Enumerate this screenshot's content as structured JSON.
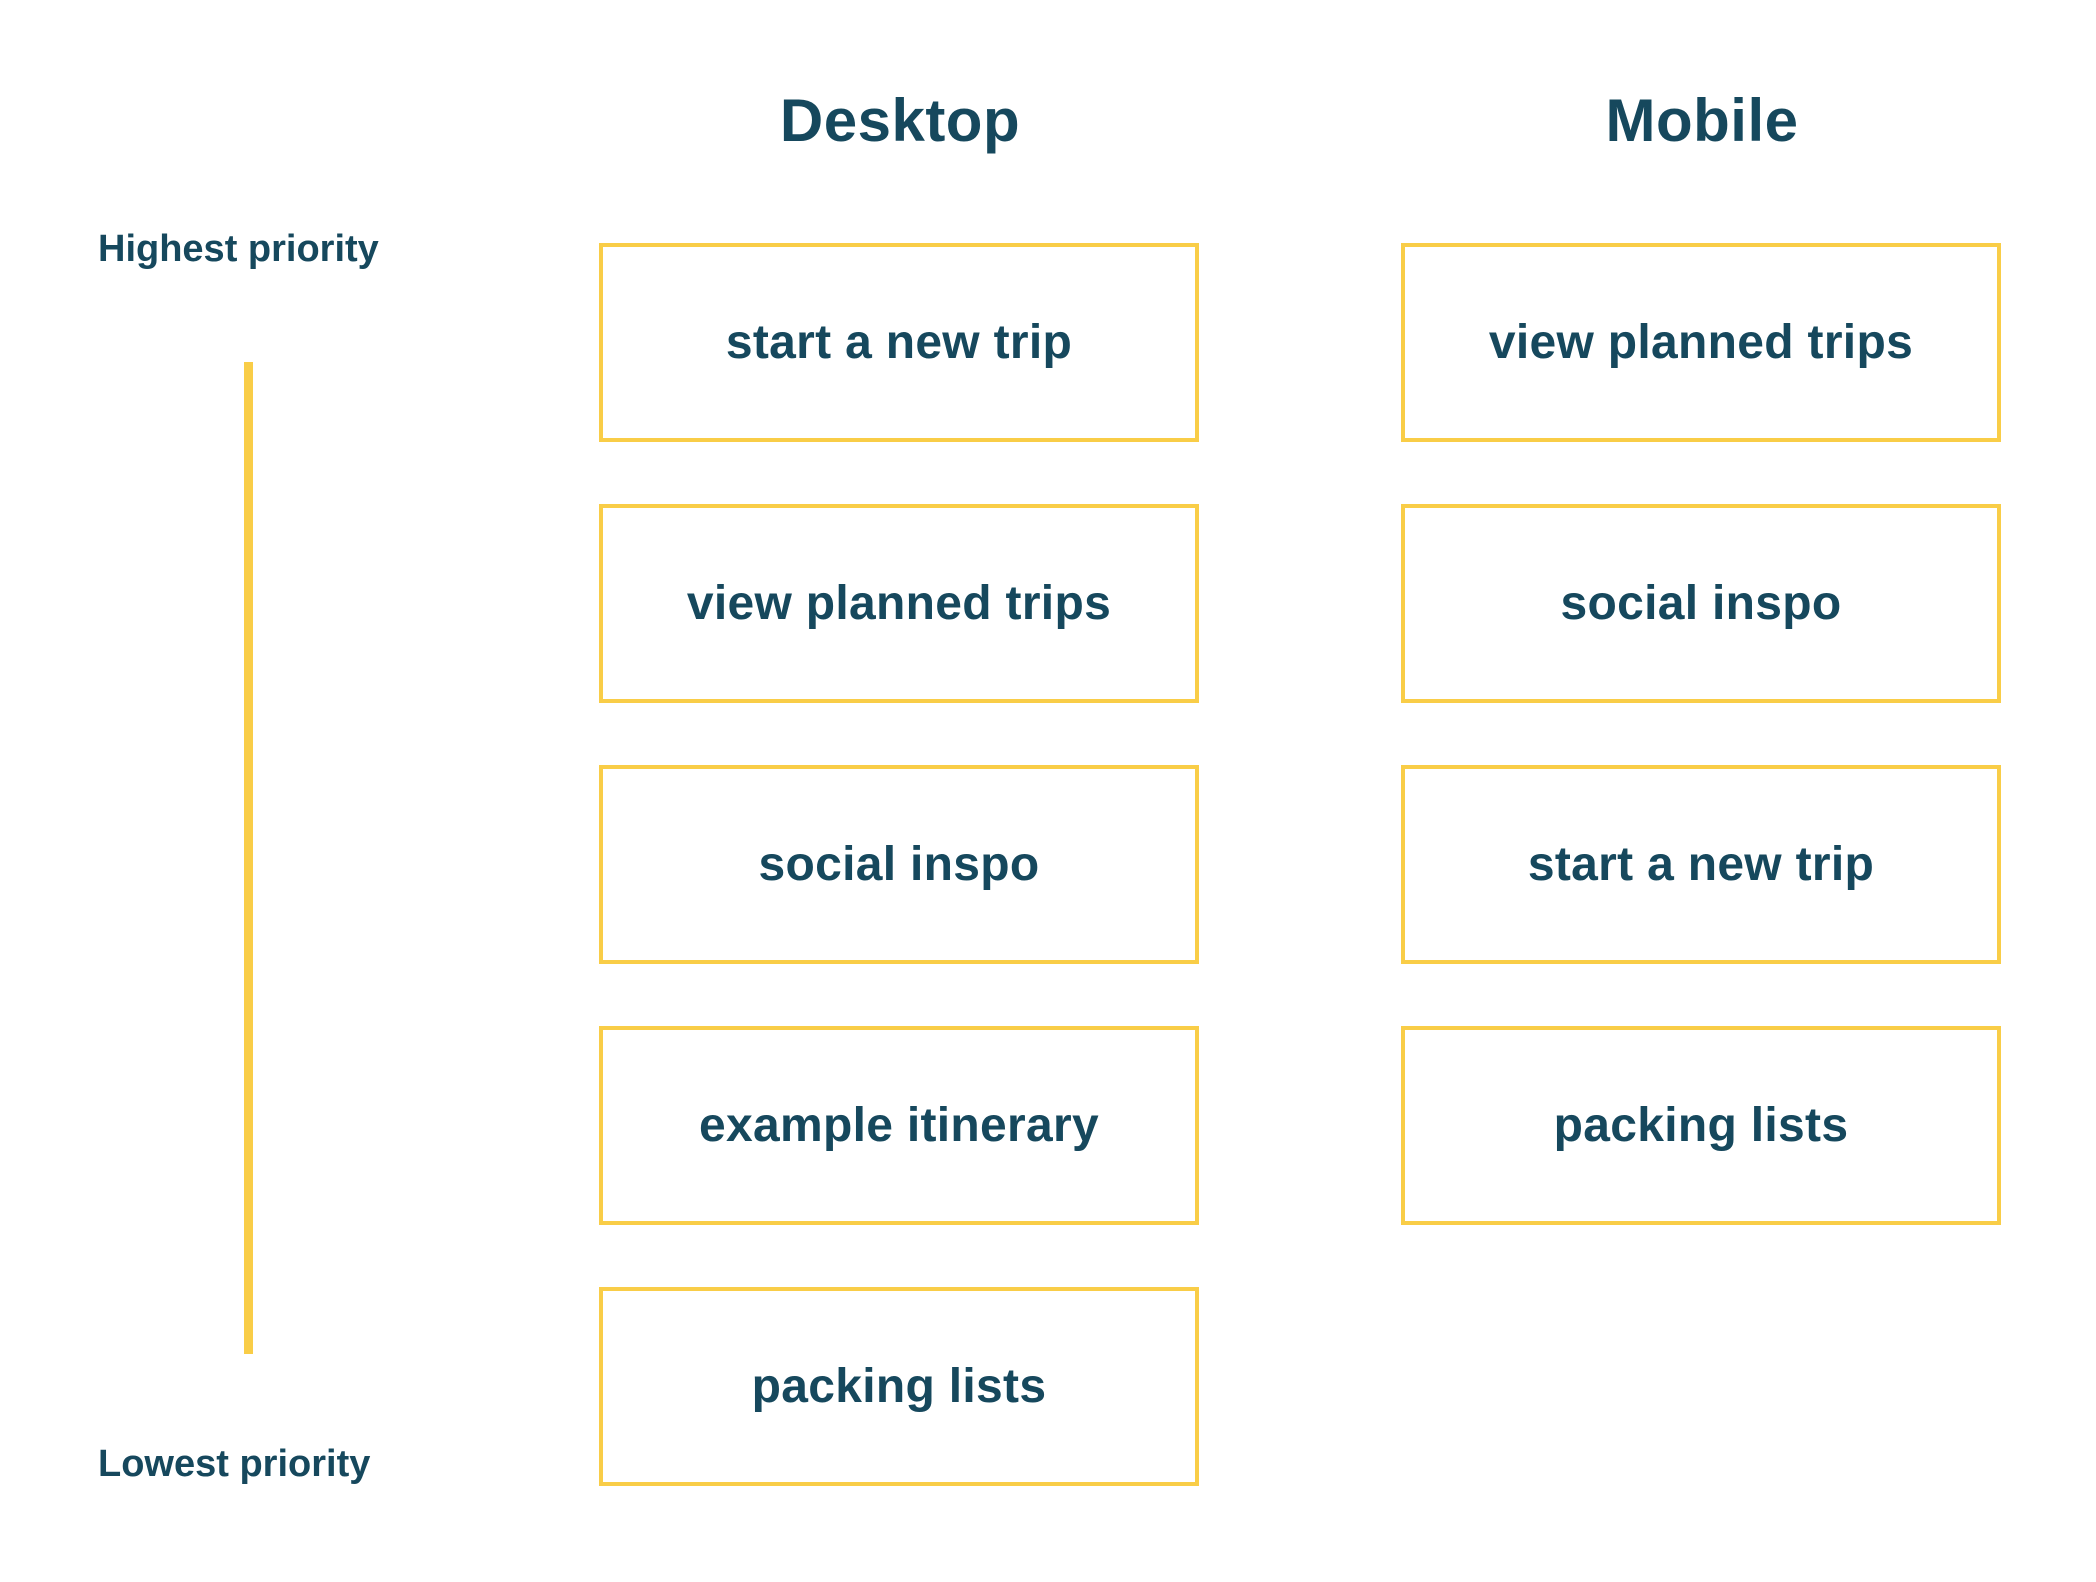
{
  "columns": [
    {
      "title": "Desktop",
      "items": [
        "start a new trip",
        "view planned trips",
        "social inspo",
        "example itinerary",
        "packing lists"
      ]
    },
    {
      "title": "Mobile",
      "items": [
        "view planned trips",
        "social inspo",
        "start a new trip",
        "packing lists"
      ]
    }
  ],
  "axis": {
    "top_label": "Highest priority",
    "bottom_label": "Lowest priority"
  },
  "colors": {
    "text": "#16485d",
    "accent": "#f9cd47",
    "background": "#ffffff"
  }
}
